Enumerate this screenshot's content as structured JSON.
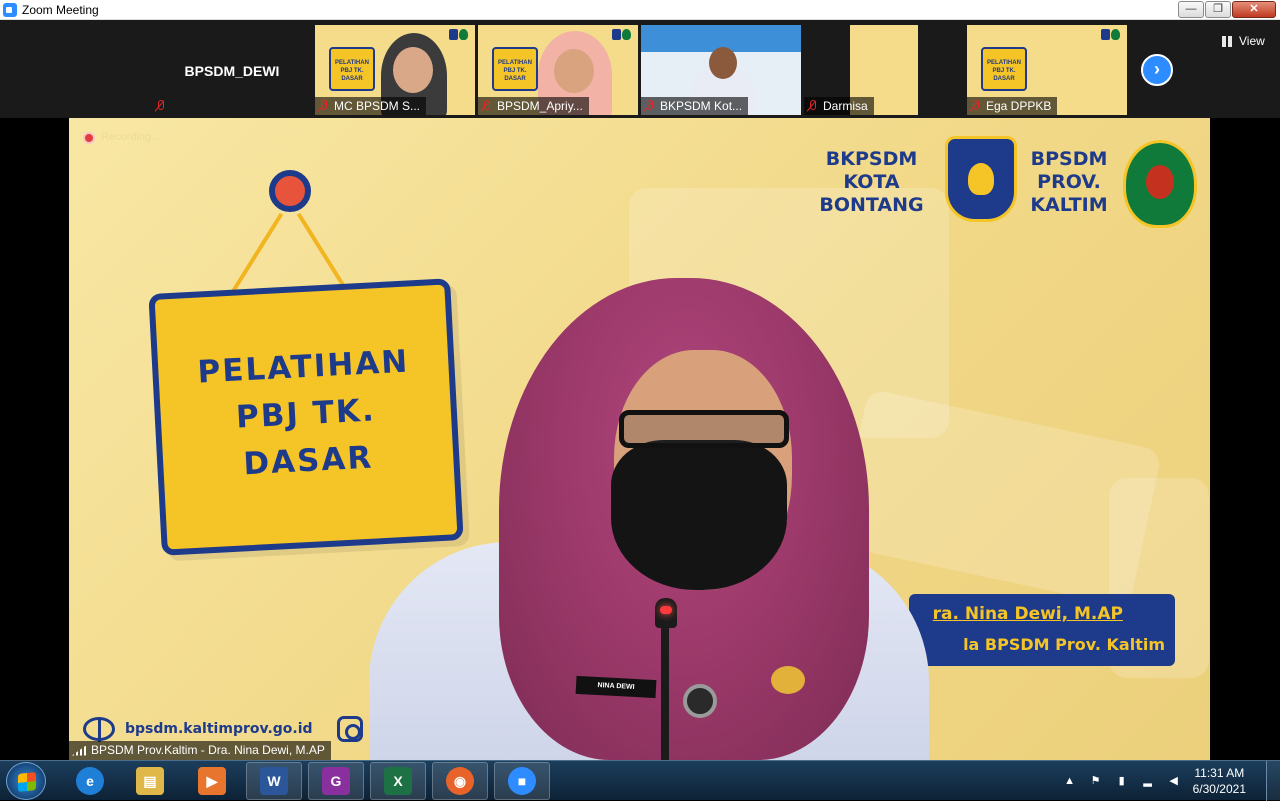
{
  "window": {
    "title": "Zoom Meeting",
    "controls": {
      "minimize": "—",
      "maximize": "❐",
      "close": "✕"
    }
  },
  "strip": {
    "tiles": [
      {
        "name": "BPSDM_DEWI",
        "muted": true,
        "video": false
      },
      {
        "name": "MC BPSDM S...",
        "muted": true,
        "video": true
      },
      {
        "name": "BPSDM_Apriy...",
        "muted": true,
        "video": true
      },
      {
        "name": "BKPSDM Kot...",
        "muted": true,
        "video": true
      },
      {
        "name": "Darmisa",
        "muted": true,
        "video": true
      },
      {
        "name": "Ega DPPKB",
        "muted": true,
        "video": true
      }
    ],
    "mini_sign_text": "PELATIHAN PBJ TK. DASAR",
    "next_icon": "chevron-right-icon",
    "view_label": "View"
  },
  "main": {
    "recording_text": "Recording...",
    "sign_text_lines": [
      "PELATIHAN",
      "PBJ TK.",
      "DASAR"
    ],
    "org_left_lines": [
      "BKPSDM",
      "KOTA",
      "BONTANG"
    ],
    "org_right_lines": [
      "BPSDM",
      "PROV.",
      "KALTIM"
    ],
    "banner_line1": "ra. Nina Dewi, M.AP",
    "banner_line2": "la BPSDM Prov. Kaltim",
    "website": "bpsdm.kaltimprov.go.id",
    "name_tag": "NINA DEWI",
    "speaker_label": "BPSDM Prov.Kaltim - Dra. Nina Dewi, M.AP"
  },
  "taskbar": {
    "apps": [
      {
        "name": "internet-explorer",
        "glyph": "e",
        "color": "#1f7fd6"
      },
      {
        "name": "file-explorer",
        "glyph": "▤",
        "color": "#e0b84a"
      },
      {
        "name": "media-player",
        "glyph": "▶",
        "color": "#e8752e"
      },
      {
        "name": "word",
        "glyph": "W",
        "color": "#2b579a"
      },
      {
        "name": "pdf-reader",
        "glyph": "G",
        "color": "#8a2f9e"
      },
      {
        "name": "excel",
        "glyph": "X",
        "color": "#1e7145"
      },
      {
        "name": "firefox",
        "glyph": "◉",
        "color": "#e8632a"
      },
      {
        "name": "zoom",
        "glyph": "■",
        "color": "#2d8cff"
      }
    ],
    "time": "11:31 AM",
    "date": "6/30/2021"
  }
}
